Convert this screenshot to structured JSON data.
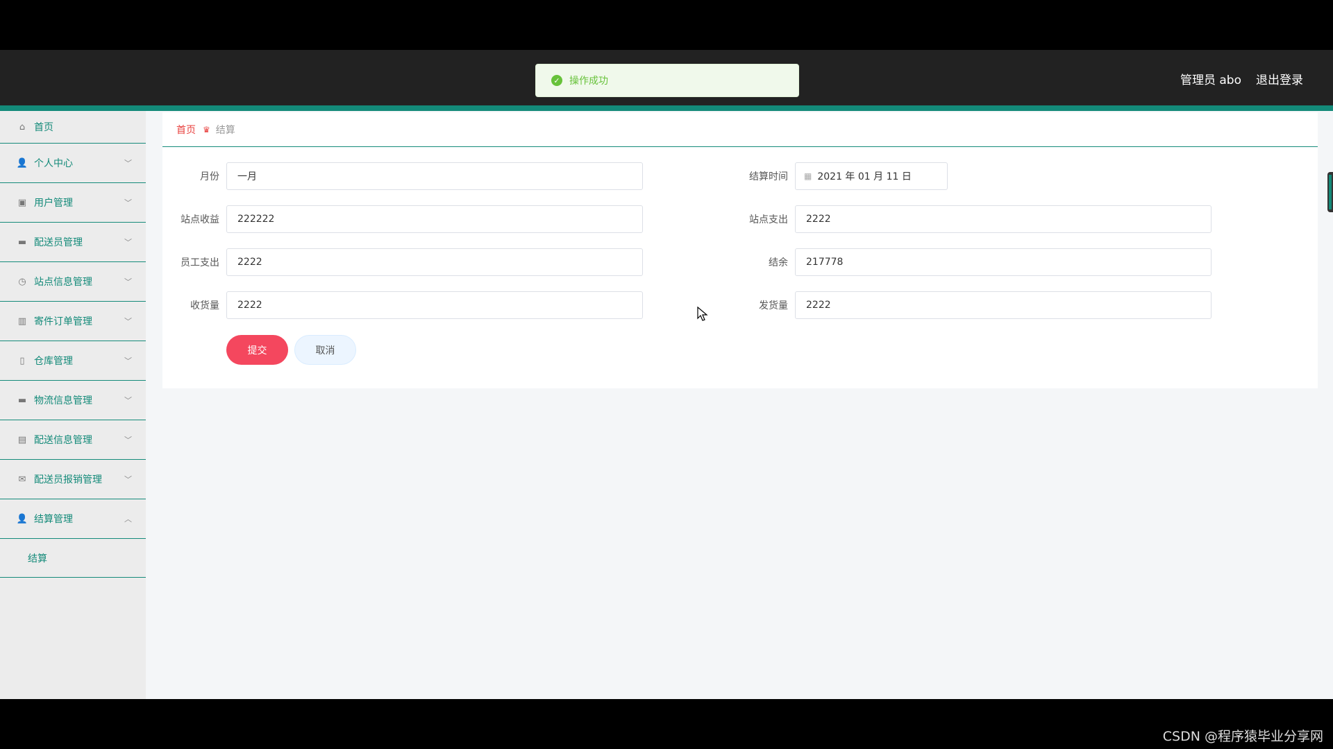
{
  "header": {
    "user_label": "管理员 abo",
    "logout_label": "退出登录"
  },
  "toast": {
    "message": "操作成功"
  },
  "sidebar": {
    "items": [
      {
        "label": "首页",
        "icon": "home-icon"
      },
      {
        "label": "个人中心",
        "icon": "user-icon"
      },
      {
        "label": "用户管理",
        "icon": "clipboard-icon"
      },
      {
        "label": "配送员管理",
        "icon": "monitor-icon"
      },
      {
        "label": "站点信息管理",
        "icon": "compass-icon"
      },
      {
        "label": "寄件订单管理",
        "icon": "bar-chart-icon"
      },
      {
        "label": "仓库管理",
        "icon": "microphone-icon"
      },
      {
        "label": "物流信息管理",
        "icon": "desktop-icon"
      },
      {
        "label": "配送信息管理",
        "icon": "briefcase-icon"
      },
      {
        "label": "配送员报销管理",
        "icon": "envelope-icon"
      },
      {
        "label": "结算管理",
        "icon": "user-icon"
      }
    ],
    "sub_items": [
      {
        "label": "结算"
      }
    ]
  },
  "breadcrumb": {
    "home": "首页",
    "current": "结算"
  },
  "form": {
    "month_label": "月份",
    "month_value": "一月",
    "settle_time_label": "结算时间",
    "settle_time_value": "2021 年 01 月 11 日",
    "site_income_label": "站点收益",
    "site_income_value": "222222",
    "site_expense_label": "站点支出",
    "site_expense_value": "2222",
    "staff_expense_label": "员工支出",
    "staff_expense_value": "2222",
    "balance_label": "结余",
    "balance_value": "217778",
    "received_label": "收货量",
    "received_value": "2222",
    "shipped_label": "发货量",
    "shipped_value": "2222",
    "submit_label": "提交",
    "cancel_label": "取消"
  },
  "watermark": "CSDN @程序猿毕业分享网",
  "colors": {
    "accent": "#138a79",
    "danger": "#f4475e",
    "success": "#67c23a",
    "header_bg": "#222222"
  }
}
